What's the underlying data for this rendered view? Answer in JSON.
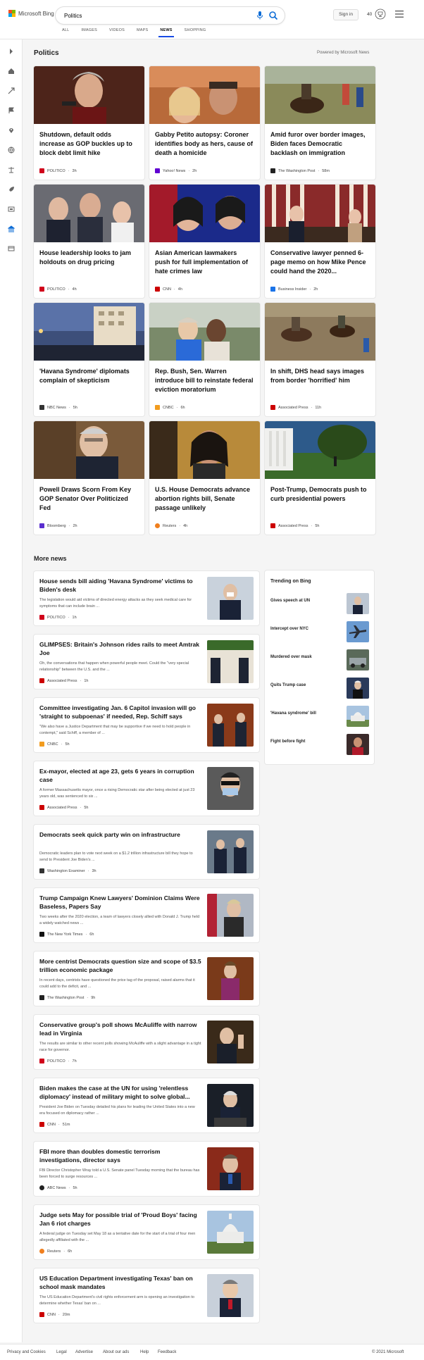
{
  "header": {
    "brand": "Microsoft Bing",
    "search_value": "Politics",
    "signin": "Sign in",
    "rewards_count": "40",
    "tabs": [
      "ALL",
      "IMAGES",
      "VIDEOS",
      "MAPS",
      "NEWS",
      "SHOPPING"
    ],
    "active_tab": "NEWS"
  },
  "section": {
    "title": "Politics",
    "powered_by": "Powered by Microsoft News"
  },
  "top_cards": [
    {
      "title": "Shutdown, default odds increase as GOP buckles up to block debt limit hike",
      "source": "POLITICO",
      "time": "3h",
      "logo_color": "#d0021b",
      "img": "img-senator"
    },
    {
      "title": "Gabby Petito autopsy: Coroner identifies body as hers, cause of death a homicide",
      "source": "Yahoo! News",
      "time": "2h",
      "logo_color": "#6001d2",
      "img": "img-selfie"
    },
    {
      "title": "Amid furor over border images, Biden faces Democratic backlash on immigration",
      "source": "The Washington Post",
      "time": "58m",
      "logo_color": "#222222",
      "img": "img-border"
    },
    {
      "title": "House leadership looks to jam holdouts on drug pricing",
      "source": "POLITICO",
      "time": "4h",
      "logo_color": "#d0021b",
      "img": "img-house"
    },
    {
      "title": "Asian American lawmakers push for full implementation of hate crimes law",
      "source": "CNN",
      "time": "4h",
      "logo_color": "#cc0000",
      "img": "img-asian"
    },
    {
      "title": "Conservative lawyer penned 6-page memo on how Mike Pence could hand the 2020...",
      "source": "Business Insider",
      "time": "2h",
      "logo_color": "#1a73e8",
      "img": "img-pence"
    },
    {
      "title": "'Havana Syndrome' diplomats complain of skepticism",
      "source": "NBC News",
      "time": "5h",
      "logo_color": "#333333",
      "img": "img-havana"
    },
    {
      "title": "Rep. Bush, Sen. Warren introduce bill to reinstate federal eviction moratorium",
      "source": "CNBC",
      "time": "6h",
      "logo_color": "#f29c1f",
      "img": "img-bush"
    },
    {
      "title": "In shift, DHS head says images from border 'horrified' him",
      "source": "Associated Press",
      "time": "11h",
      "logo_color": "#cc0000",
      "img": "img-horse"
    },
    {
      "title": "Powell Draws Scorn From Key GOP Senator Over Politicized Fed",
      "source": "Bloomberg",
      "time": "2h",
      "logo_color": "#5a2fcf",
      "img": "img-powell"
    },
    {
      "title": "U.S. House Democrats advance abortion rights bill, Senate passage unlikely",
      "source": "Reuters",
      "time": "4h",
      "logo_color": "#f07f1e",
      "img": "img-abortion"
    },
    {
      "title": "Post-Trump, Democrats push to curb presidential powers",
      "source": "Associated Press",
      "time": "5h",
      "logo_color": "#cc0000",
      "img": "img-whitehouse"
    }
  ],
  "more_news": {
    "title": "More news",
    "items": [
      {
        "title": "House sends bill aiding 'Havana Syndrome' victims to Biden's desk",
        "snippet": "The legislation would aid victims of directed energy attacks as they seek medical care for symptoms that can include brain ...",
        "source": "POLITICO",
        "time": "1h",
        "logo_color": "#d0021b"
      },
      {
        "title": "GLIMPSES: Britain's Johnson rides rails to meet Amtrak Joe",
        "snippet": "Oh, the conversations that happen when powerful people meet. Could the \"very special relationship\" between the U.S. and the ...",
        "source": "Associated Press",
        "time": "1h",
        "logo_color": "#cc0000"
      },
      {
        "title": "Committee investigating Jan. 6 Capitol invasion will go 'straight to subpoenas' if needed, Rep. Schiff says",
        "snippet": "\"We also have a Justice Department that may be supportive if we need to hold people in contempt,\" said Schiff, a member of ...",
        "source": "CNBC",
        "time": "5h",
        "logo_color": "#f29c1f"
      },
      {
        "title": "Ex-mayor, elected at age 23, gets 6 years in corruption case",
        "snippet": "A former Massachusetts mayor, once a rising Democratic star after being elected at just 23 years old, was sentenced to six ...",
        "source": "Associated Press",
        "time": "5h",
        "logo_color": "#cc0000"
      },
      {
        "title": "Democrats seek quick party win on infrastructure",
        "snippet": "Democratic leaders plan to vote next week on a $1.2 trillion infrastructure bill they hope to send to President Joe Biden's ...",
        "source": "Washington Examiner",
        "time": "3h",
        "logo_color": "#333333"
      },
      {
        "title": "Trump Campaign Knew Lawyers' Dominion Claims Were Baseless, Papers Say",
        "snippet": "Two weeks after the 2020 election, a team of lawyers closely allied with Donald J. Trump held a widely watched news ...",
        "source": "The New York Times",
        "time": "6h",
        "logo_color": "#111111"
      },
      {
        "title": "More centrist Democrats question size and scope of $3.5 trillion economic package",
        "snippet": "In recent days, centrists have questioned the price tag of the proposal, raised alarms that it could add to the deficit, and ...",
        "source": "The Washington Post",
        "time": "9h",
        "logo_color": "#222222"
      },
      {
        "title": "Conservative group's poll shows McAuliffe with narrow lead in Virginia",
        "snippet": "The results are similar to other recent polls showing McAuliffe with a slight advantage in a tight race for governor.",
        "source": "POLITICO",
        "time": "7h",
        "logo_color": "#d0021b"
      },
      {
        "title": "Biden makes the case at the UN for using 'relentless diplomacy' instead of military might to solve global...",
        "snippet": "President Joe Biden on Tuesday detailed his plans for leading the United States into a new era focused on diplomacy rather ...",
        "source": "CNN",
        "time": "51m",
        "logo_color": "#cc0000"
      },
      {
        "title": "FBI more than doubles domestic terrorism investigations, director says",
        "snippet": "FBI Director Christopher Wray told a U.S. Senate panel Tuesday morning that the bureau has been forced to surge resources ...",
        "source": "ABC News",
        "time": "5h",
        "logo_color": "#222222"
      },
      {
        "title": "Judge sets May for possible trial of 'Proud Boys' facing Jan 6 riot charges",
        "snippet": "A federal judge on Tuesday set May 18 as a tentative date for the start of a trial of four men allegedly affiliated with the ...",
        "source": "Reuters",
        "time": "6h",
        "logo_color": "#f07f1e"
      },
      {
        "title": "US Education Department investigating Texas' ban on school mask mandates",
        "snippet": "The US Education Department's civil rights enforcement arm is opening an investigation to determine whether Texas' ban on ...",
        "source": "CNN",
        "time": "20m",
        "logo_color": "#cc0000"
      }
    ]
  },
  "trending": {
    "title": "Trending on Bing",
    "items": [
      "Gives speech at UN",
      "Intercept over NYC",
      "Murdered over mask",
      "Quits Trump case",
      "'Havana syndrome' bill",
      "Fight before fight"
    ]
  },
  "footer": {
    "links": [
      "Privacy and Cookies",
      "Legal",
      "Advertise",
      "About our ads",
      "Help",
      "Feedback"
    ],
    "copyright": "© 2021 Microsoft"
  }
}
